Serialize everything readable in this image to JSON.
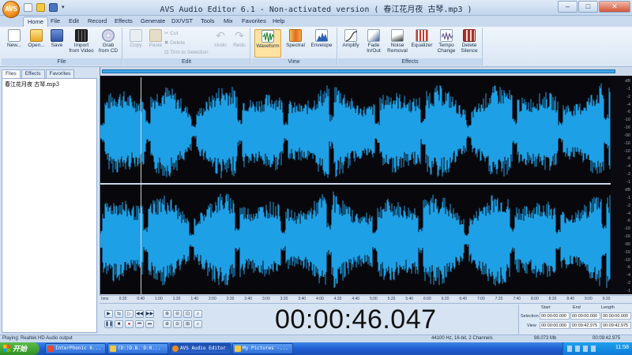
{
  "window": {
    "title": "AVS Audio Editor 6.1 - Non-activated version ( 春江花月夜 古琴.mp3 )",
    "app_orb": "AVS"
  },
  "menu_tabs": [
    "Home",
    "File",
    "Edit",
    "Record",
    "Effects",
    "Generate",
    "DX/VST",
    "Tools",
    "Mix",
    "Favorites",
    "Help"
  ],
  "active_tab": "Home",
  "ribbon": {
    "file": {
      "label": "File",
      "buttons": [
        {
          "label": "New...",
          "icon": "new-file-icon"
        },
        {
          "label": "Open...",
          "icon": "folder-open-icon"
        },
        {
          "label": "Save",
          "icon": "save-icon"
        },
        {
          "label": "Import\nfrom Video",
          "icon": "film-icon"
        },
        {
          "label": "Grab\nfrom CD",
          "icon": "cd-icon"
        }
      ]
    },
    "edit": {
      "label": "Edit",
      "copy": "Copy",
      "paste": "Paste",
      "cut": "Cut",
      "delete": "Delete",
      "trim": "Trim to Selection",
      "undo": "Undo",
      "redo": "Redo"
    },
    "view": {
      "label": "View",
      "buttons": [
        {
          "label": "Waveform",
          "icon": "waveform-icon"
        },
        {
          "label": "Spectral",
          "icon": "spectral-icon"
        },
        {
          "label": "Envelope",
          "icon": "envelope-icon"
        }
      ]
    },
    "effects": {
      "label": "Effects",
      "buttons": [
        {
          "label": "Amplify",
          "icon": "amplify-icon"
        },
        {
          "label": "Fade\nIn/Out",
          "icon": "fade-icon"
        },
        {
          "label": "Noise\nRemoval",
          "icon": "noise-icon"
        },
        {
          "label": "Equalizer",
          "icon": "equalizer-icon"
        },
        {
          "label": "Tempo\nChange",
          "icon": "tempo-icon"
        },
        {
          "label": "Delete\nSilence",
          "icon": "delete-silence-icon"
        }
      ]
    }
  },
  "left_panel": {
    "tabs": [
      "Files",
      "Effects",
      "Favorites"
    ],
    "files": [
      "春江花月夜 古琴.mp3"
    ]
  },
  "waveform": {
    "db_labels": [
      "dB",
      "-1",
      "-2",
      "-4",
      "-6",
      "-10",
      "-16",
      "-90",
      "-16",
      "-10",
      "-6",
      "-4",
      "-2",
      "-1"
    ],
    "time_labels": [
      "hms",
      "0:20",
      "0:40",
      "1:00",
      "1:20",
      "1:40",
      "2:00",
      "2:20",
      "2:40",
      "3:00",
      "3:20",
      "3:40",
      "4:00",
      "4:20",
      "4:40",
      "5:00",
      "5:20",
      "5:40",
      "6:00",
      "6:20",
      "6:40",
      "7:00",
      "7:20",
      "7:40",
      "8:00",
      "8:20",
      "8:40",
      "9:00",
      "9:20"
    ],
    "color": "#1ea0e6"
  },
  "transport": {
    "time": "00:00:46.047",
    "selection": {
      "headers": [
        "Start",
        "End",
        "Length"
      ],
      "rows": [
        {
          "label": "Selection",
          "start": "00:00:00.000",
          "end": "00:00:00.000",
          "length": "00:00:00.000"
        },
        {
          "label": "View",
          "start": "00:00:00.000",
          "end": "00:09:42.975",
          "length": "00:09:42.975"
        }
      ]
    }
  },
  "status": {
    "playing": "Playing: Realtek HD Audio output",
    "format": "44100 Hz, 16-bit, 2 Channels",
    "size": "98.073 Mb",
    "position": "00:09:42.975"
  },
  "taskbar": {
    "start": "开始",
    "tasks": [
      "InterPhonic 6...",
      "(D:)D.B. D:0...",
      "AVS Audio Editor",
      "My Pictures -..."
    ],
    "clock": "11:58"
  }
}
